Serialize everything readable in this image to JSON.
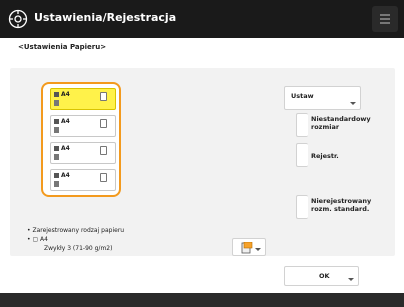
{
  "header": {
    "title": "Ustawienia/Rejestracja",
    "gear_icon": "gear-icon",
    "menu_icon": "menu-icon"
  },
  "subtitle": "<Ustawienia Papieru>",
  "drawers": [
    {
      "size": "A4",
      "selected": true
    },
    {
      "size": "A4",
      "selected": false
    },
    {
      "size": "A4",
      "selected": false
    },
    {
      "size": "A4",
      "selected": false
    }
  ],
  "buttons": {
    "set": "Ustaw",
    "nonstandard": "Niestandardowy rozmiar",
    "register": "Rejestr.",
    "nonstandard_name": "Nierejestrowany rozm. standard."
  },
  "legend": {
    "line1": "Zarejestrowany rodzaj papieru",
    "size": "A4",
    "type": "Zwykły 3 (71-90 g/m2)"
  },
  "ok_label": "OK",
  "colors": {
    "header_bg": "#1a1a1a",
    "selection": "#f39a1e",
    "active_drawer": "#fff24a"
  }
}
